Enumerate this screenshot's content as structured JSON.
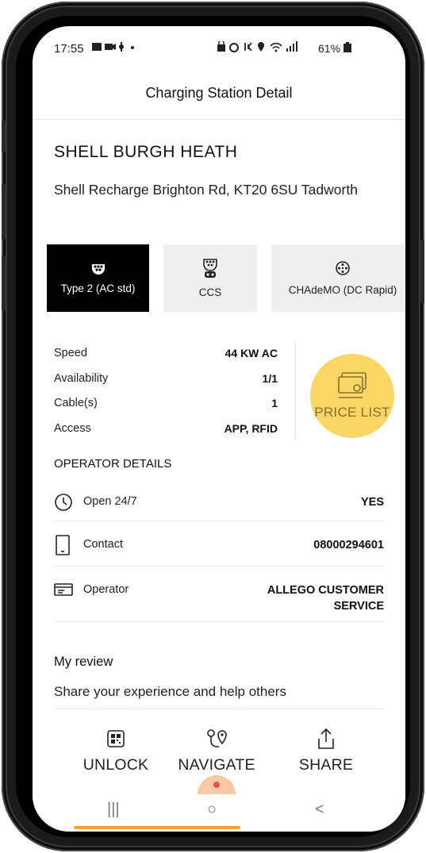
{
  "status_bar": {
    "time": "17:55",
    "battery": "61%",
    "left_icons": [
      "notification-icons",
      "video-icon",
      "usb-icon",
      "dot"
    ],
    "right_icons": [
      "lock-icon",
      "alarm-icon",
      "mute-icon",
      "location-icon",
      "wifi-icon",
      "signal-icon"
    ]
  },
  "header": {
    "title": "Charging Station Detail"
  },
  "station": {
    "name": "SHELL BURGH HEATH",
    "address": "Shell Recharge Brighton Rd, KT20 6SU Tadworth"
  },
  "connectors": [
    {
      "label": "Type 2 (AC std)",
      "icon": "type2-plug-icon",
      "active": true
    },
    {
      "label": "CCS",
      "icon": "ccs-plug-icon",
      "active": false
    },
    {
      "label": "CHAdeMO (DC Rapid)",
      "icon": "chademo-plug-icon",
      "active": false
    }
  ],
  "specs": [
    {
      "label": "Speed",
      "value": "44 KW AC"
    },
    {
      "label": "Availability",
      "value": "1/1"
    },
    {
      "label": "Cable(s)",
      "value": "1"
    },
    {
      "label": "Access",
      "value": "APP, RFID"
    }
  ],
  "price_list": {
    "label": "PRICE LIST",
    "icon": "price-list-icon"
  },
  "operator_details": {
    "title": "OPERATOR DETAILS",
    "rows": [
      {
        "label": "Open 24/7",
        "value": "YES",
        "icon": "clock-icon"
      },
      {
        "label": "Contact",
        "value": "08000294601",
        "icon": "phone-icon"
      },
      {
        "label": "Operator",
        "value_line1": "ALLEGO CUSTOMER",
        "value_line2": "SERVICE",
        "icon": "operator-card-icon"
      }
    ]
  },
  "review": {
    "title": "My review",
    "subtitle": "Share your experience and help others"
  },
  "actions": [
    {
      "label": "UNLOCK",
      "icon": "qr-icon"
    },
    {
      "label": "NAVIGATE",
      "icon": "route-icon"
    },
    {
      "label": "SHARE",
      "icon": "share-icon"
    }
  ],
  "system_nav": {
    "recent": "|||",
    "home": "○",
    "back": "<"
  },
  "colors": {
    "active_tab": "#000000",
    "price_list_bg": "#f8d766",
    "price_list_text": "#8a6f29",
    "accent": "#f5a03a"
  }
}
